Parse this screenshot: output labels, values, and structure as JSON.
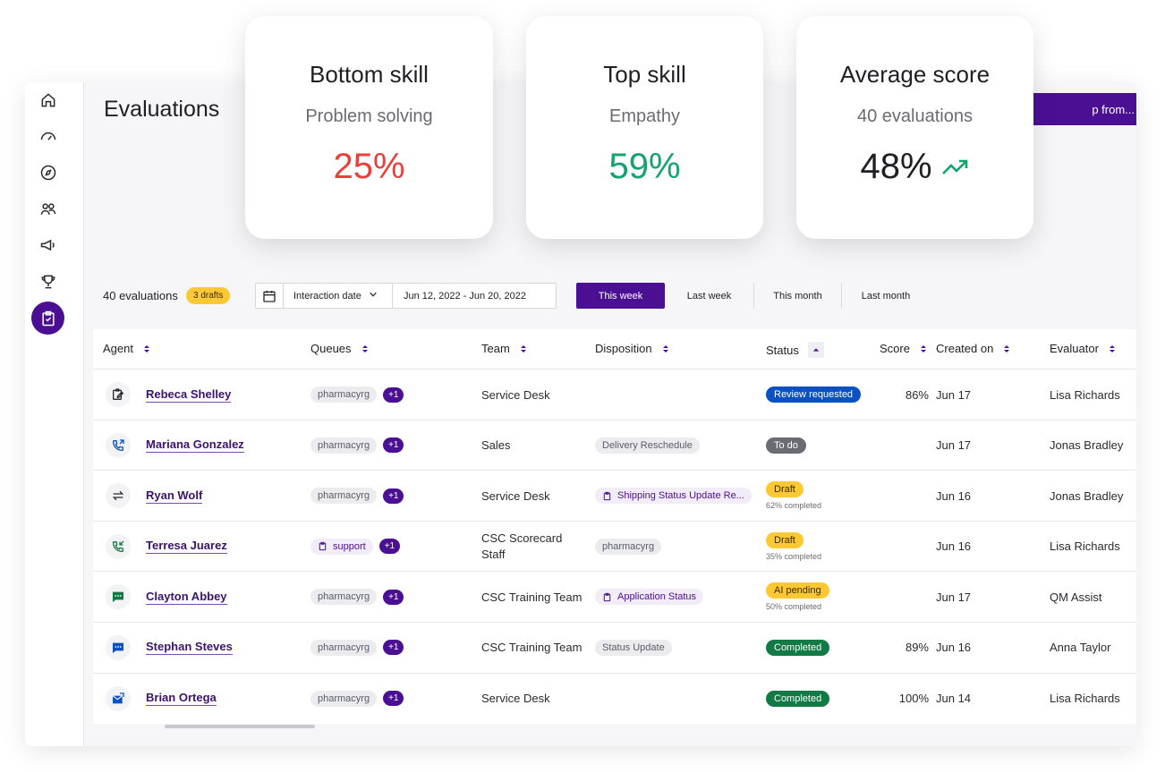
{
  "cards": [
    {
      "title": "Bottom skill",
      "subtitle": "Problem solving",
      "value": "25%",
      "color": "#e8403a"
    },
    {
      "title": "Top skill",
      "subtitle": "Empathy",
      "value": "59%",
      "color": "#13a36c"
    },
    {
      "title": "Average score",
      "subtitle": "40 evaluations",
      "value": "48%",
      "color": "#1f1f24",
      "trend_icon": "trending-up-icon"
    }
  ],
  "page": {
    "title": "Evaluations",
    "import_label": "p from..."
  },
  "sidebar": {
    "items": [
      "home-icon",
      "dashboard-gauge-icon",
      "compass-icon",
      "team-icon",
      "megaphone-icon",
      "trophy-icon",
      "clipboard-check-icon"
    ],
    "active": "clipboard-check-icon"
  },
  "toolbar": {
    "count": "40 evaluations",
    "drafts": "3 drafts",
    "date_type": "Interaction date",
    "date_range": "Jun 12, 2022 - Jun 20, 2022",
    "periods": [
      "This week",
      "Last week",
      "This month",
      "Last month"
    ],
    "active_period": "This week"
  },
  "table": {
    "columns": [
      "Agent",
      "Queues",
      "Team",
      "Disposition",
      "Status",
      "Score",
      "Created on",
      "Evaluator"
    ],
    "rows": [
      {
        "channel": "form-edit-icon",
        "agent": "Rebeca Shelley",
        "queue": "pharmacyrg",
        "queue_extra": "+1",
        "team": "Service Desk",
        "disposition": "",
        "status": "Review requested",
        "status_sub": "",
        "score": "86%",
        "created": "Jun 17",
        "evaluator": "Lisa Richards"
      },
      {
        "channel": "phone-outgoing-icon",
        "agent": "Mariana Gonzalez",
        "queue": "pharmacyrg",
        "queue_extra": "+1",
        "team": "Sales",
        "disposition": "Delivery Reschedule",
        "status": "To do",
        "status_sub": "",
        "score": "",
        "created": "Jun 17",
        "evaluator": "Jonas Bradley"
      },
      {
        "channel": "transfer-icon",
        "agent": "Ryan Wolf",
        "queue": "pharmacyrg",
        "queue_extra": "+1",
        "team": "Service Desk",
        "disposition": "Shipping Status Update Re...",
        "status": "Draft",
        "status_sub": "62% completed",
        "score": "",
        "created": "Jun 16",
        "evaluator": "Jonas Bradley"
      },
      {
        "channel": "phone-incoming-icon",
        "agent": "Terresa Juarez",
        "queue": "support",
        "queue_extra": "+1",
        "team": "CSC Scorecard Staff",
        "disposition": "pharmacyrg",
        "status": "Draft",
        "status_sub": "35% completed",
        "score": "",
        "created": "Jun 16",
        "evaluator": "Lisa Richards"
      },
      {
        "channel": "chat-green-icon",
        "agent": "Clayton Abbey",
        "queue": "pharmacyrg",
        "queue_extra": "+1",
        "team": "CSC Training Team",
        "disposition": "Application Status",
        "status": "AI pending",
        "status_sub": "50% completed",
        "score": "",
        "created": "Jun 17",
        "evaluator": "QM Assist"
      },
      {
        "channel": "chat-blue-icon",
        "agent": "Stephan Steves",
        "queue": "pharmacyrg",
        "queue_extra": "+1",
        "team": "CSC Training Team",
        "disposition": "Status Update",
        "status": "Completed",
        "status_sub": "",
        "score": "89%",
        "created": "Jun 16",
        "evaluator": "Anna Taylor"
      },
      {
        "channel": "email-icon",
        "agent": "Brian Ortega",
        "queue": "pharmacyrg",
        "queue_extra": "+1",
        "team": "Service Desk",
        "disposition": "",
        "status": "Completed",
        "status_sub": "",
        "score": "100%",
        "created": "Jun 14",
        "evaluator": "Lisa Richards"
      }
    ]
  }
}
